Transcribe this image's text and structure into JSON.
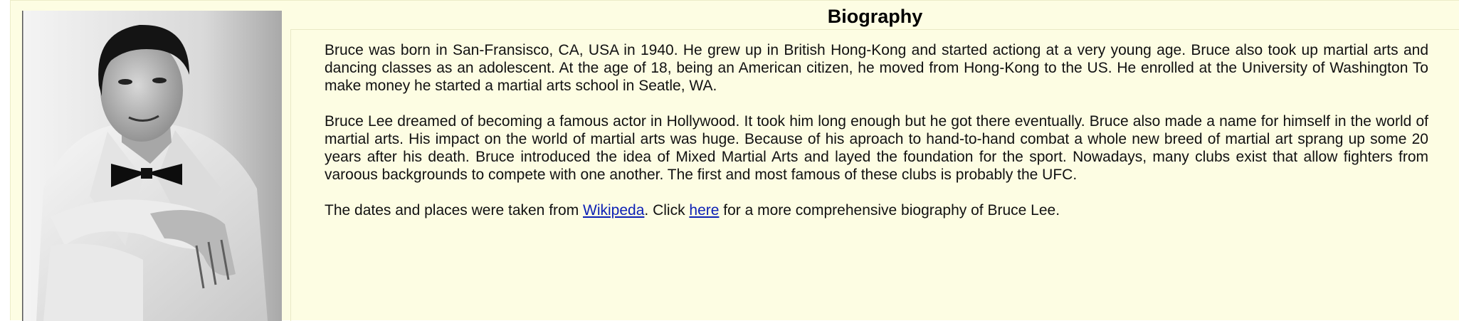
{
  "page": {
    "title": "Biography"
  },
  "photo": {
    "icon": "portrait-photo"
  },
  "bio": {
    "paragraph_1": "Bruce was born in San-Fransisco, CA, USA in 1940. He grew up in British Hong-Kong and started actiong at a very young age. Bruce also took up martial arts and dancing classes as an adolescent. At the age of 18, being an American citizen, he moved from Hong-Kong to the US. He enrolled at the University of Washington To make money he started a martial arts school in Seatle, WA.",
    "paragraph_2": "Bruce Lee dreamed of becoming a famous actor in Hollywood. It took him long enough but he got there eventually. Bruce also made a name for himself in the world of martial arts. His impact on the world of martial arts was huge. Because of his aproach to hand-to-hand combat a whole new breed of martial art sprang up some 20 years after his death. Bruce introduced the idea of Mixed Martial Arts and layed the foundation for the sport. Nowadays, many clubs exist that allow fighters from varoous backgrounds to compete with one another. The first and most famous of these clubs is probably the UFC.",
    "source_prefix": "The dates and places were taken from ",
    "wikipedia_link": "Wikipeda",
    "source_middle": ". Click ",
    "here_link": "here",
    "source_suffix": " for a more comprehensive biography of Bruce Lee."
  },
  "colors": {
    "background": "#fdfde3",
    "link": "#0b1fb5"
  }
}
